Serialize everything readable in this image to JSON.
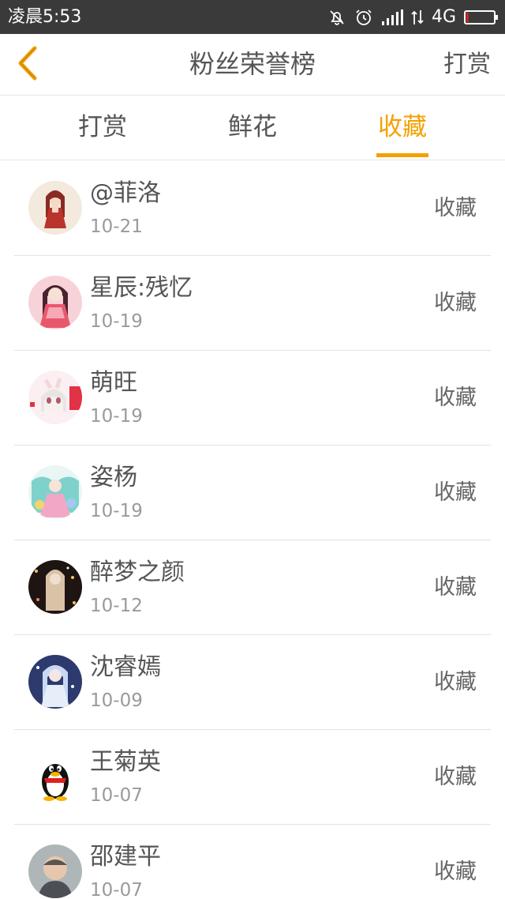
{
  "statusbar": {
    "time": "凌晨5:53",
    "network": "4G",
    "battery_level": 0.08
  },
  "navbar": {
    "title": "粉丝荣誉榜",
    "right_label": "打赏"
  },
  "tabs": [
    {
      "label": "打赏",
      "active": false
    },
    {
      "label": "鲜花",
      "active": false
    },
    {
      "label": "收藏",
      "active": true
    }
  ],
  "colors": {
    "accent": "#f5a000",
    "text": "#555555",
    "secondary": "#9a9a9a",
    "statusbar": "#3a3a3a",
    "battery_low": "#e02020"
  },
  "items": [
    {
      "name": "@菲洛",
      "date": "10-21",
      "action": "收藏",
      "avatar": "anime-girl-red-avatar"
    },
    {
      "name": "星辰:残忆",
      "date": "10-19",
      "action": "收藏",
      "avatar": "anime-girl-pink-avatar"
    },
    {
      "name": "萌旺",
      "date": "10-19",
      "action": "收藏",
      "avatar": "anime-girl-white-avatar"
    },
    {
      "name": "姿杨",
      "date": "10-19",
      "action": "收藏",
      "avatar": "anime-girl-teal-avatar"
    },
    {
      "name": "醉梦之颜",
      "date": "10-12",
      "action": "收藏",
      "avatar": "dark-sparkle-avatar"
    },
    {
      "name": "沈睿嫣",
      "date": "10-09",
      "action": "收藏",
      "avatar": "anime-girl-blue-avatar"
    },
    {
      "name": "王菊英",
      "date": "10-07",
      "action": "收藏",
      "avatar": "qq-penguin-avatar"
    },
    {
      "name": "邵建平",
      "date": "10-07",
      "action": "收藏",
      "avatar": "photo-man-avatar"
    }
  ]
}
